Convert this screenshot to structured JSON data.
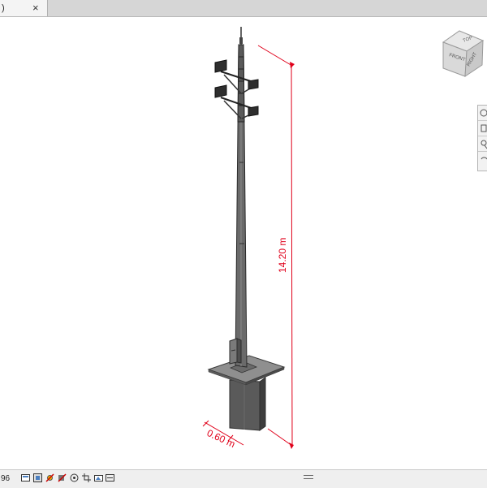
{
  "tab": {
    "label": ")",
    "close": "×"
  },
  "viewcube": {
    "top": "TOP",
    "front": "FRONT",
    "right": "RIGHT"
  },
  "dimensions": {
    "height": "14.20 m",
    "width": "0.60 m"
  },
  "status": {
    "scale": "96"
  },
  "colors": {
    "dimension": "#e0001a",
    "pole": "#555555",
    "base": "#5e5e5e"
  }
}
